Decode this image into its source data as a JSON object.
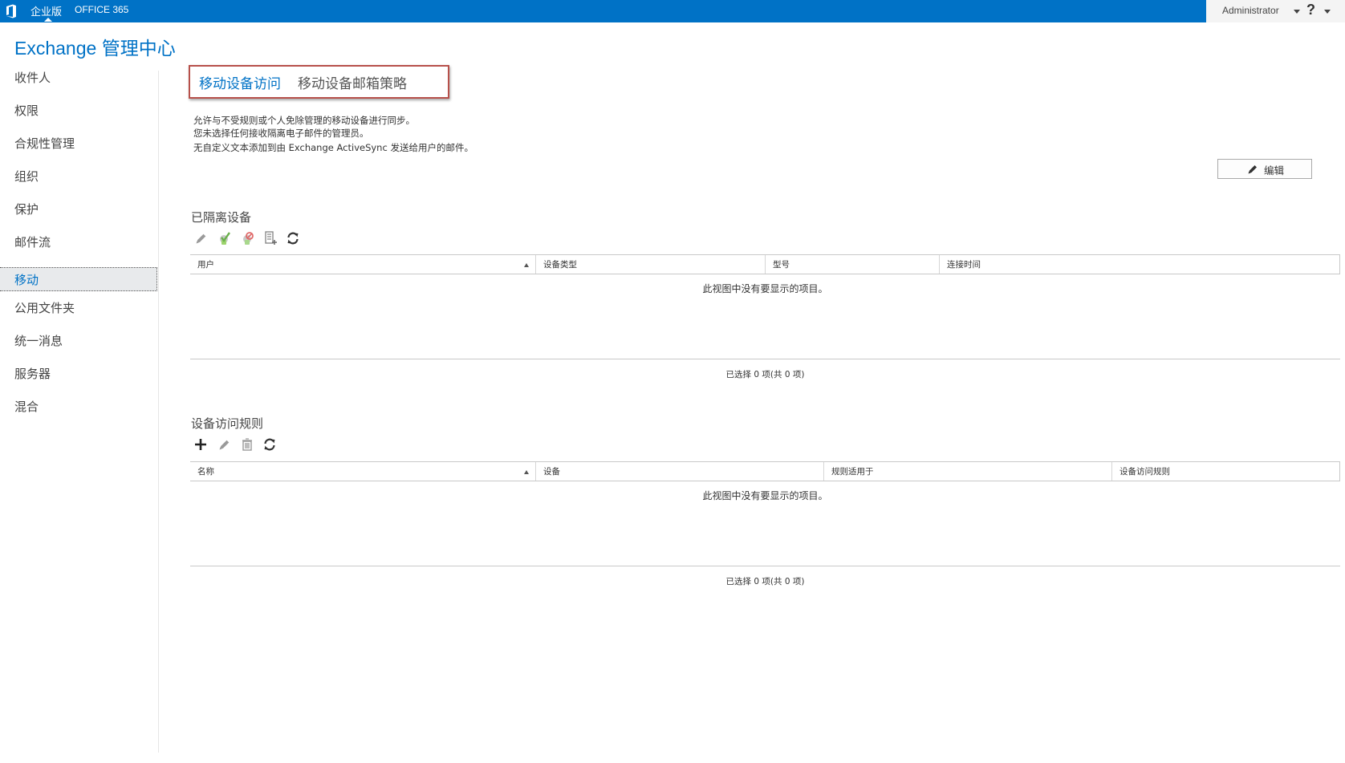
{
  "topbar": {
    "edition": "企业版",
    "office": "OFFICE 365",
    "user": "Administrator",
    "help": "?",
    "icons": [
      "office-logo-icon",
      "chevron-down-icon",
      "help-icon"
    ]
  },
  "app_title": "Exchange 管理中心",
  "sidebar": {
    "items": [
      {
        "label": "收件人"
      },
      {
        "label": "权限"
      },
      {
        "label": "合规性管理"
      },
      {
        "label": "组织"
      },
      {
        "label": "保护"
      },
      {
        "label": "邮件流"
      },
      {
        "label": "移动",
        "active": true
      },
      {
        "label": "公用文件夹"
      },
      {
        "label": "统一消息"
      },
      {
        "label": "服务器"
      },
      {
        "label": "混合"
      }
    ]
  },
  "tabs": [
    {
      "label": "移动设备访问",
      "active": true
    },
    {
      "label": "移动设备邮箱策略",
      "active": false
    }
  ],
  "description": [
    "允许与不受规则或个人免除管理的移动设备进行同步。",
    "您未选择任何接收隔离电子邮件的管理员。",
    "无自定义文本添加到由 Exchange ActiveSync 发送给用户的邮件。"
  ],
  "edit_button": {
    "label": "编辑",
    "icon": "pencil-icon"
  },
  "quarantined": {
    "title": "已隔离设备",
    "toolbar": [
      "pencil-icon",
      "allow-icon",
      "block-icon",
      "details-icon",
      "refresh-icon"
    ],
    "columns": [
      "用户",
      "设备类型",
      "型号",
      "连接时间"
    ],
    "empty_message": "此视图中没有要显示的项目。",
    "count": "已选择 0 项(共 0 项)"
  },
  "rules": {
    "title": "设备访问规则",
    "toolbar": [
      "add-icon",
      "pencil-icon",
      "delete-icon",
      "refresh-icon"
    ],
    "columns": [
      "名称",
      "设备",
      "规则适用于",
      "设备访问规则"
    ],
    "empty_message": "此视图中没有要显示的项目。",
    "count": "已选择 0 项(共 0 项)"
  },
  "colors": {
    "accent": "#0072c6",
    "tab_highlight_border": "#b7504a",
    "nav_active_bg": "#e8eaec"
  }
}
